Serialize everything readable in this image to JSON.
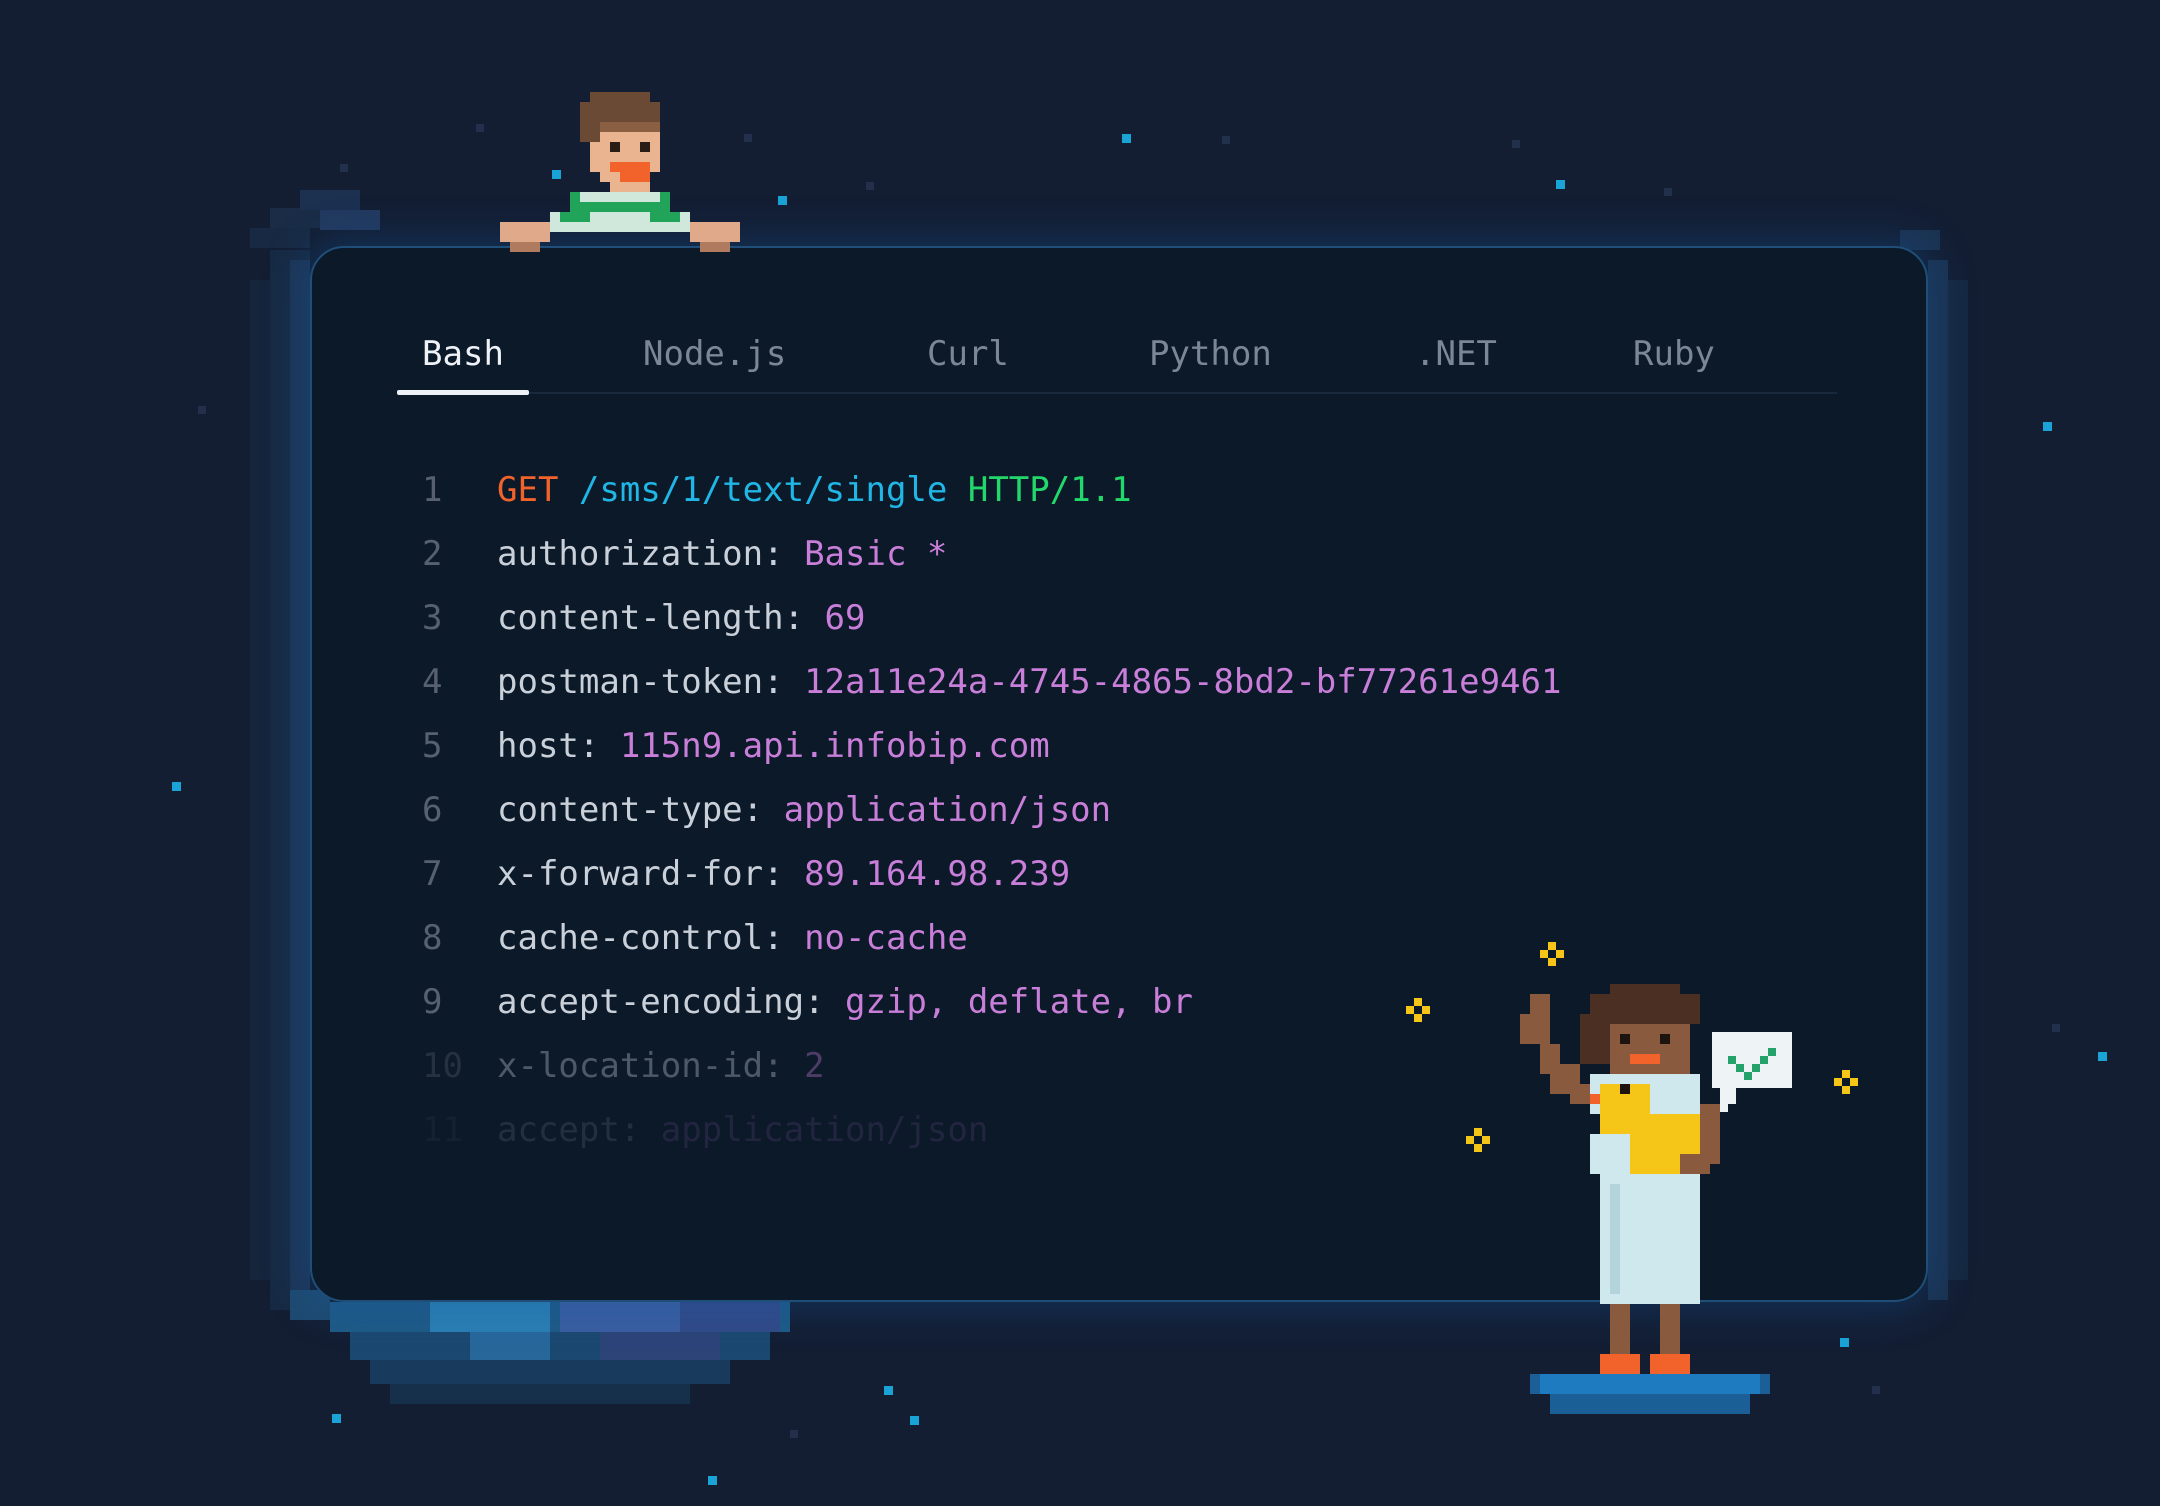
{
  "colors": {
    "background": "#131e33",
    "panel": "#0b1929",
    "accent_star": "#1aa3d6",
    "method": "#f2632b",
    "path": "#20b6e6",
    "protocol": "#23d86b",
    "header_key": "#c9d0d9",
    "header_value": "#c97fd9"
  },
  "tabs": [
    {
      "label": "Bash",
      "active": true
    },
    {
      "label": "Node.js",
      "active": false
    },
    {
      "label": "Curl",
      "active": false
    },
    {
      "label": "Python",
      "active": false
    },
    {
      "label": ".NET",
      "active": false
    },
    {
      "label": "Ruby",
      "active": false
    }
  ],
  "request_line": {
    "number": "1",
    "method": "GET",
    "path": "/sms/1/text/single",
    "protocol": "HTTP/1.1"
  },
  "headers": [
    {
      "number": "2",
      "key": "authorization:",
      "value": "Basic *"
    },
    {
      "number": "3",
      "key": "content-length:",
      "value": "69"
    },
    {
      "number": "4",
      "key": "postman-token:",
      "value": "12a11e24a-4745-4865-8bd2-bf77261e9461"
    },
    {
      "number": "5",
      "key": "host:",
      "value": "115n9.api.infobip.com"
    },
    {
      "number": "6",
      "key": "content-type:",
      "value": "application/json"
    },
    {
      "number": "7",
      "key": "x-forward-for:",
      "value": "89.164.98.239"
    },
    {
      "number": "8",
      "key": "cache-control:",
      "value": "no-cache"
    },
    {
      "number": "9",
      "key": "accept-encoding:",
      "value": "gzip, deflate, br"
    },
    {
      "number": "10",
      "key": "x-location-id:",
      "value": "2"
    },
    {
      "number": "11",
      "key": "accept:",
      "value": "application/json"
    }
  ],
  "icons": [
    "pixel-boy-icon",
    "pixel-girl-with-duck-icon",
    "checkmark-speech-bubble-icon",
    "sparkle-icon"
  ]
}
